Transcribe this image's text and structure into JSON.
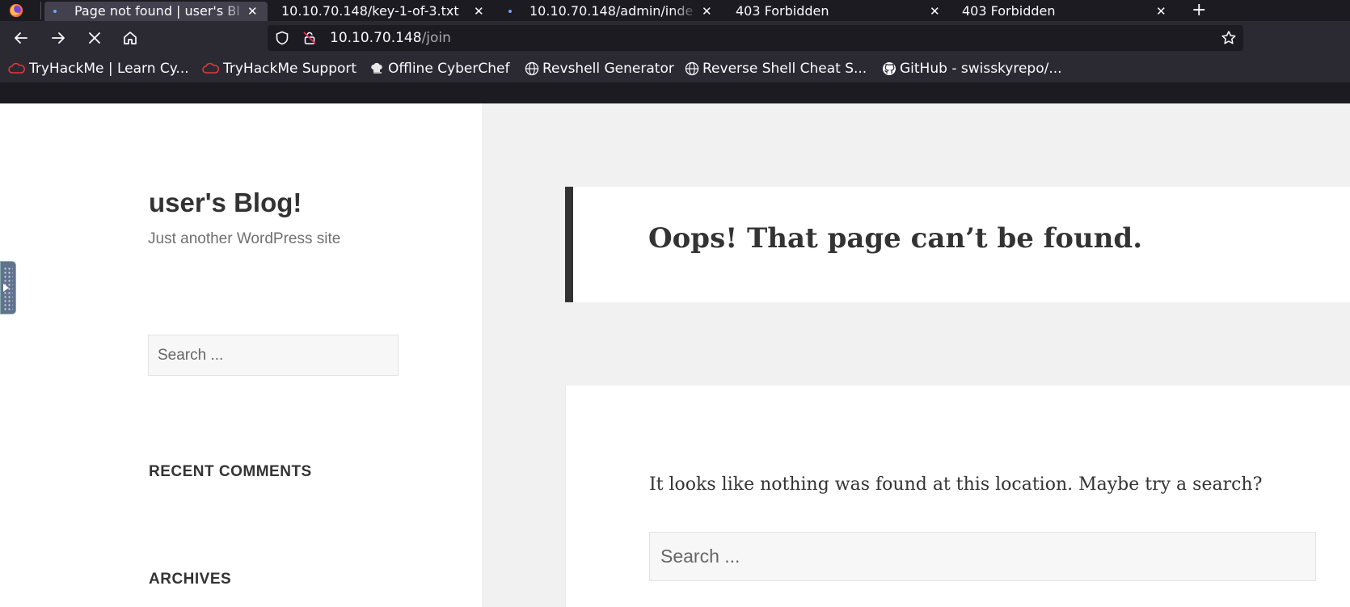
{
  "browser": {
    "tabs": [
      {
        "title": "Page not found | user's Bl",
        "active": true
      },
      {
        "title": "10.10.70.148/key-1-of-3.txt"
      },
      {
        "title": "10.10.70.148/admin/inde"
      },
      {
        "title": "403 Forbidden"
      },
      {
        "title": "403 Forbidden"
      }
    ],
    "new_tab_label": "+",
    "close_glyph": "✕",
    "url_host": "10.10.70.148",
    "url_path": "/join",
    "icons": {
      "back": "back-arrow-icon",
      "forward": "forward-arrow-icon",
      "stop": "stop-loading-icon",
      "home": "home-icon",
      "shield": "tracking-protection-shield-icon",
      "lock": "insecure-lock-icon",
      "star": "bookmark-star-icon"
    }
  },
  "bookmarks": [
    {
      "label": "TryHackMe | Learn Cy...",
      "icon": "tryhackme-cloud-icon"
    },
    {
      "label": "TryHackMe Support",
      "icon": "tryhackme-cloud-icon"
    },
    {
      "label": "Offline CyberChef",
      "icon": "chef-hat-icon"
    },
    {
      "label": "Revshell Generator",
      "icon": "globe-icon"
    },
    {
      "label": "Reverse Shell Cheat S...",
      "icon": "globe-icon"
    },
    {
      "label": "GitHub - swisskyrepo/...",
      "icon": "github-icon"
    }
  ],
  "site": {
    "title": "user's Blog!",
    "description": "Just another WordPress site",
    "sidebar_search_placeholder": "Search ...",
    "widgets": [
      "RECENT COMMENTS",
      "ARCHIVES"
    ]
  },
  "main": {
    "heading": "Oops! That page can’t be found.",
    "message": "It looks like nothing was found at this location. Maybe try a search?",
    "search_placeholder": "Search ..."
  },
  "colors": {
    "tab_bar": "#1c1b22",
    "toolbar": "#2b2a33",
    "accent_dot": "#6aa7ff",
    "page_bg": "#f1f1f1",
    "card_border": "#333333"
  }
}
